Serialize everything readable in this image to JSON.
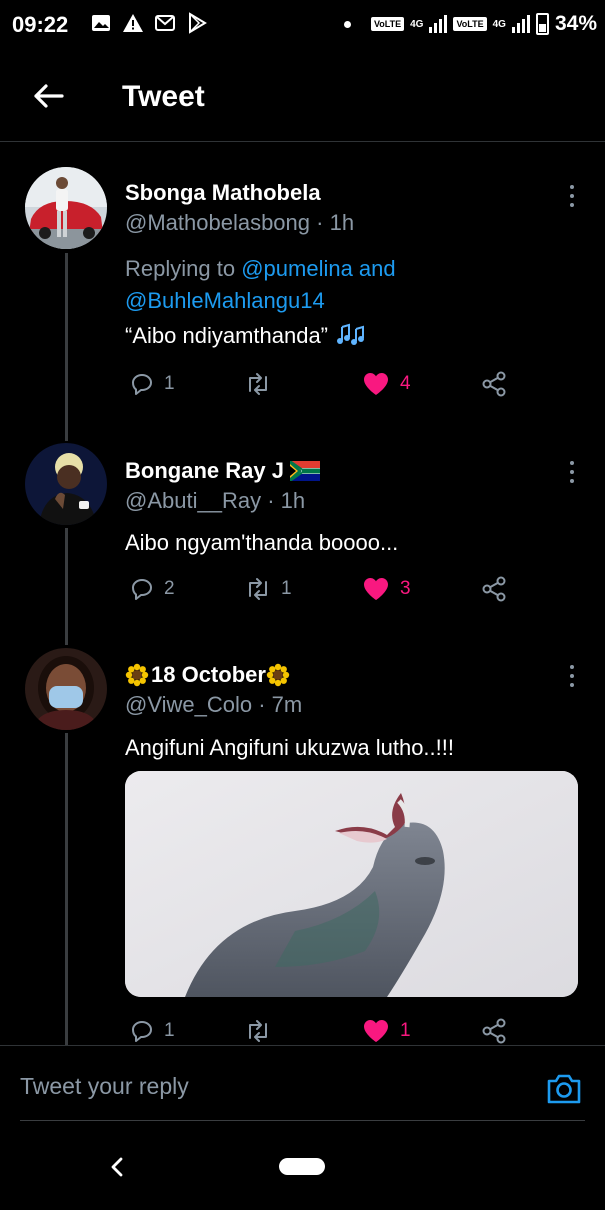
{
  "status_bar": {
    "time": "09:22",
    "left_icons": [
      "photo-icon",
      "alert-icon",
      "gmail-icon",
      "play-store-icon"
    ],
    "sim1": {
      "volte": "VoLTE",
      "network": "4G"
    },
    "sim2": {
      "volte": "VoLTE",
      "network": "4G"
    },
    "battery": "34%"
  },
  "header": {
    "back_icon": "back-arrow-icon",
    "title": "Tweet"
  },
  "tweets": [
    {
      "name": "Sbonga Mathobela",
      "handle": "@Mathobelasbong",
      "time": "1h",
      "reply_prefix": "Replying to",
      "reply_link_1": "@pumelina and",
      "reply_link_2": "@BuhleMahlangu14",
      "text": "“Aibo ndiyamthanda”",
      "emoji": "music-notes-icon",
      "replies": "1",
      "retweets": "",
      "likes": "4",
      "liked": true
    },
    {
      "name": "Bongane Ray J",
      "name_flag": "south-africa-flag-icon",
      "handle": "@Abuti__Ray",
      "time": "1h",
      "text": "Aibo ngyam'thanda boooo...",
      "replies": "2",
      "retweets": "1",
      "likes": "3",
      "liked": true
    },
    {
      "name": "18 October",
      "name_emoji": "sunflower-icon",
      "handle": "@Viwe_Colo",
      "time": "7m",
      "text": "Angifuni Angifuni ukuzwa lutho..!!!",
      "media": "pigeon-photo",
      "replies": "1",
      "retweets": "",
      "likes": "1",
      "liked": true
    }
  ],
  "reply_bar": {
    "placeholder": "Tweet your reply",
    "camera_icon": "camera-icon"
  },
  "nav_bar": {
    "back_icon": "nav-back-icon",
    "home_icon": "home-pill-icon"
  },
  "colors": {
    "background": "#000000",
    "accent": "#1d9bf0",
    "like": "#f91880",
    "muted": "#8b98a5",
    "divider": "#2f3336"
  }
}
